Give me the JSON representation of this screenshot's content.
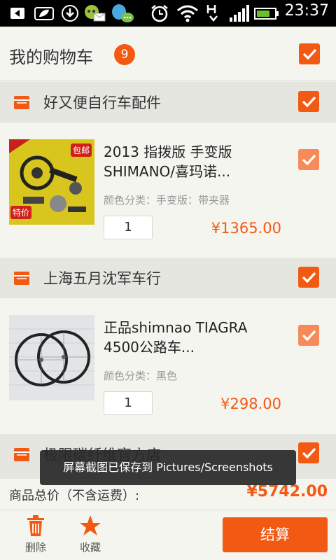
{
  "statusbar": {
    "time": "23:37"
  },
  "header": {
    "title": "我的购物车",
    "count": "9"
  },
  "shops": [
    {
      "name": "好又便自行车配件",
      "item": {
        "title_line1": "2013 指拨版 手变版",
        "title_line2": "SHIMANO/喜玛诺...",
        "spec": "颜色分类：手变版：带夹器",
        "quantity": "1",
        "price": "¥1365.00",
        "thumb_badge_top": "包邮",
        "thumb_badge_bottom": "特价"
      }
    },
    {
      "name": "上海五月沈军车行",
      "item": {
        "title_line1": "正品shimnao TIAGRA",
        "title_line2": "4500公路车...",
        "spec": "颜色分类：黑色",
        "quantity": "1",
        "price": "¥298.00"
      }
    },
    {
      "name": "极限碳纤维官方店"
    }
  ],
  "toast": "屏幕截图已保存到 Pictures/Screenshots",
  "footer": {
    "total_label": "商品总价（不含运费）:",
    "total_value": "¥5742.00",
    "delete_label": "删除",
    "favorite_label": "收藏",
    "checkout_label": "结算"
  },
  "colors": {
    "accent": "#f25a14",
    "shop_bg": "#e6e6e0",
    "page_bg": "#f5f5f0"
  }
}
